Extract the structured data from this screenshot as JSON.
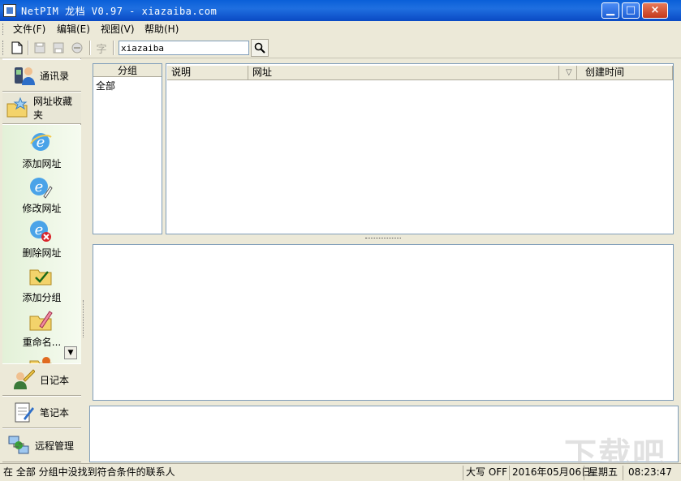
{
  "window": {
    "title": "NetPIM 龙档  V0.97 - xiazaiba.com",
    "minimize_label": "▁",
    "maximize_label": "□",
    "close_label": "×"
  },
  "menu": {
    "items": [
      {
        "label": "文件(F)"
      },
      {
        "label": "编辑(E)"
      },
      {
        "label": "视图(V)"
      },
      {
        "label": "帮助(H)"
      }
    ]
  },
  "toolbar": {
    "font_label": "字",
    "search_value": "xiazaiba",
    "icons": [
      "new-document-icon",
      "save-icon",
      "save-copy-icon",
      "stop-icon",
      "font-icon",
      "search-icon"
    ]
  },
  "nav": {
    "sections_top": [
      {
        "label": "通讯录",
        "icon": "contacts-icon"
      },
      {
        "label": "网址收藏夹",
        "icon": "folder-star-icon"
      }
    ],
    "actions": [
      {
        "label": "添加网址",
        "icon": "ie-add-icon"
      },
      {
        "label": "修改网址",
        "icon": "ie-edit-icon"
      },
      {
        "label": "删除网址",
        "icon": "ie-delete-icon"
      },
      {
        "label": "添加分组",
        "icon": "folder-check-icon"
      },
      {
        "label": "重命名...",
        "icon": "rename-icon"
      }
    ],
    "scroll_label": "▼",
    "sections_bottom": [
      {
        "label": "日记本",
        "icon": "diary-icon"
      },
      {
        "label": "笔记本",
        "icon": "notebook-icon"
      },
      {
        "label": "远程管理",
        "icon": "remote-icon"
      }
    ]
  },
  "groups": {
    "header": "分组",
    "items": [
      "全部"
    ]
  },
  "table": {
    "columns": [
      "说明",
      "网址",
      "▽",
      "创建时间"
    ]
  },
  "status": {
    "message": "在 全部 分组中没找到符合条件的联系人",
    "caps": "大写 OFF",
    "date": "2016年05月06日",
    "weekday": "星期五",
    "time": "08:23:47"
  },
  "watermark": "下载吧"
}
